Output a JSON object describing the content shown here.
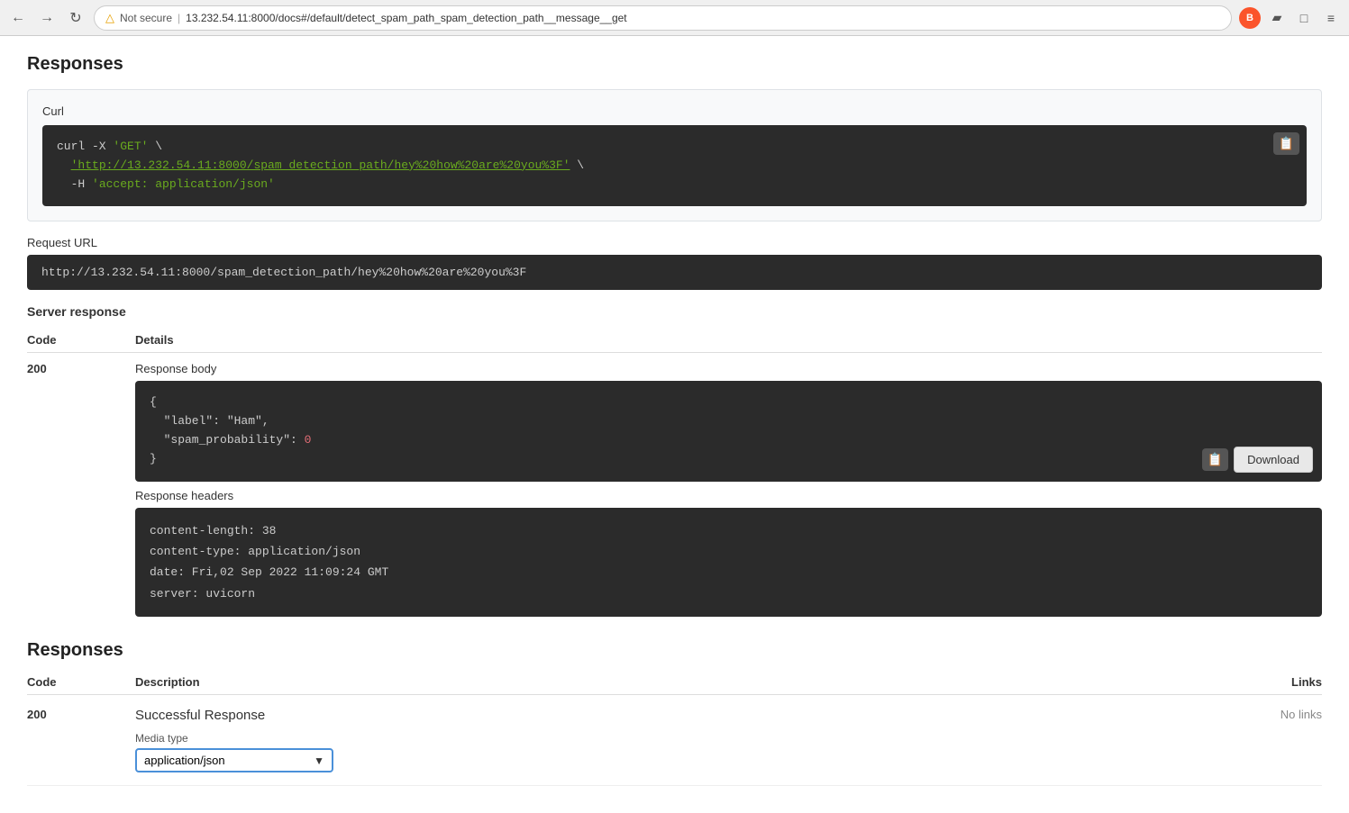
{
  "browser": {
    "not_secure_text": "Not secure",
    "url": "13.232.54.11:8000/docs#/default/detect_spam_path_spam_detection_path__message__get",
    "reload_icon": "↻",
    "back_icon": "←",
    "forward_icon": "→"
  },
  "page": {
    "responses_title": "Responses",
    "curl_label": "Curl",
    "curl_line1": "curl -X 'GET' \\",
    "curl_line2_prefix": "  '",
    "curl_line2_url": "http://13.232.54.11:8000/spam_detection_path/hey%20how%20are%20you%3F",
    "curl_line2_suffix": "' \\",
    "curl_line3": "  -H 'accept: application/json'",
    "request_url_label": "Request URL",
    "request_url_value": "http://13.232.54.11:8000/spam_detection_path/hey%20how%20are%20you%3F",
    "server_response_title": "Server response",
    "code_header": "Code",
    "details_header": "Details",
    "code_200": "200",
    "response_body_label": "Response body",
    "response_body_line1": "{",
    "response_body_line2_prefix": "  \"label\": \"",
    "response_body_line2_value": "Ham",
    "response_body_line2_suffix": "\",",
    "response_body_line3_prefix": "  \"spam_probability\": ",
    "response_body_line3_value": "0",
    "response_body_line4": "}",
    "download_btn_label": "Download",
    "response_headers_label": "Response headers",
    "header_line1": "content-length: 38",
    "header_line2": "content-type: application/json",
    "header_line3": "date: Fri,02 Sep 2022 11:09:24 GMT",
    "header_line4": "server: uvicorn",
    "bottom_responses_title": "Responses",
    "bottom_code_header": "Code",
    "bottom_desc_header": "Description",
    "bottom_links_header": "Links",
    "bottom_code_200": "200",
    "bottom_desc_value": "Successful Response",
    "bottom_links_value": "No links",
    "media_type_label": "Media type",
    "media_type_value": "application/json"
  }
}
